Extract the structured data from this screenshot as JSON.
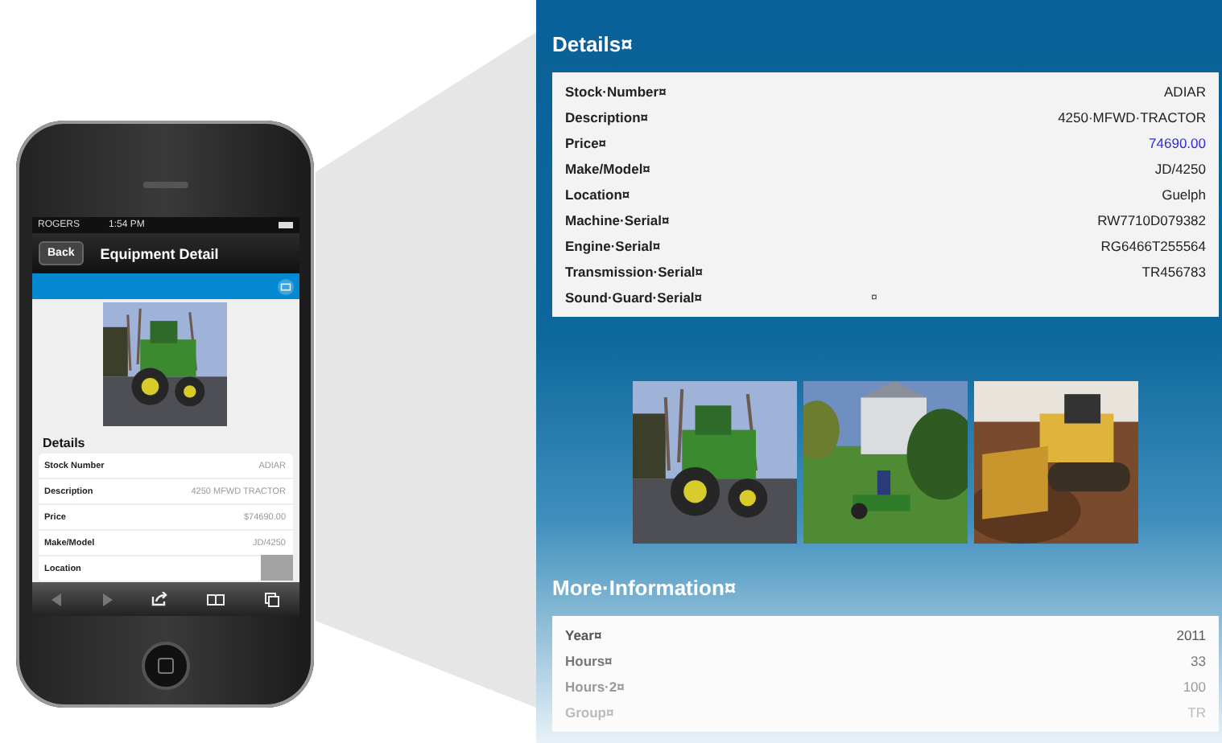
{
  "phone": {
    "status": {
      "carrier": "ROGERS",
      "time": "1:54 PM"
    },
    "nav": {
      "back": "Back",
      "title": "Equipment Detail"
    },
    "section_title": "Details",
    "rows": [
      {
        "label": "Stock Number",
        "value": "ADIAR"
      },
      {
        "label": "Description",
        "value": "4250 MFWD TRACTOR"
      },
      {
        "label": "Price",
        "value": "$74690.00"
      },
      {
        "label": "Make/Model",
        "value": "JD/4250"
      },
      {
        "label": "Location"
      }
    ]
  },
  "panel": {
    "details_title": "Details¤",
    "details": [
      {
        "label": "Stock·Number¤",
        "value": "ADIAR"
      },
      {
        "label": "Description¤",
        "value": "4250·MFWD·TRACTOR"
      },
      {
        "label": "Price¤",
        "value": "74690.00",
        "link": true
      },
      {
        "label": "Make/Model¤",
        "value": "JD/4250"
      },
      {
        "label": "Location¤",
        "value": "Guelph"
      },
      {
        "label": "Machine·Serial¤",
        "value": "RW7710D079382"
      },
      {
        "label": "Engine·Serial¤",
        "value": "RG6466T255564"
      },
      {
        "label": "Transmission·Serial¤",
        "value": "TR456783"
      },
      {
        "label": "Sound·Guard·Serial¤",
        "mark": "¤"
      }
    ],
    "photos": [
      {
        "kind": "tractor"
      },
      {
        "kind": "mower"
      },
      {
        "kind": "dozer"
      }
    ],
    "more_title": "More·Information¤",
    "more": [
      {
        "label": "Year¤",
        "value": "2011"
      },
      {
        "label": "Hours¤",
        "value": "33"
      },
      {
        "label": "Hours·2¤",
        "value": "100"
      },
      {
        "label": "Group¤",
        "value": "TR"
      }
    ]
  }
}
